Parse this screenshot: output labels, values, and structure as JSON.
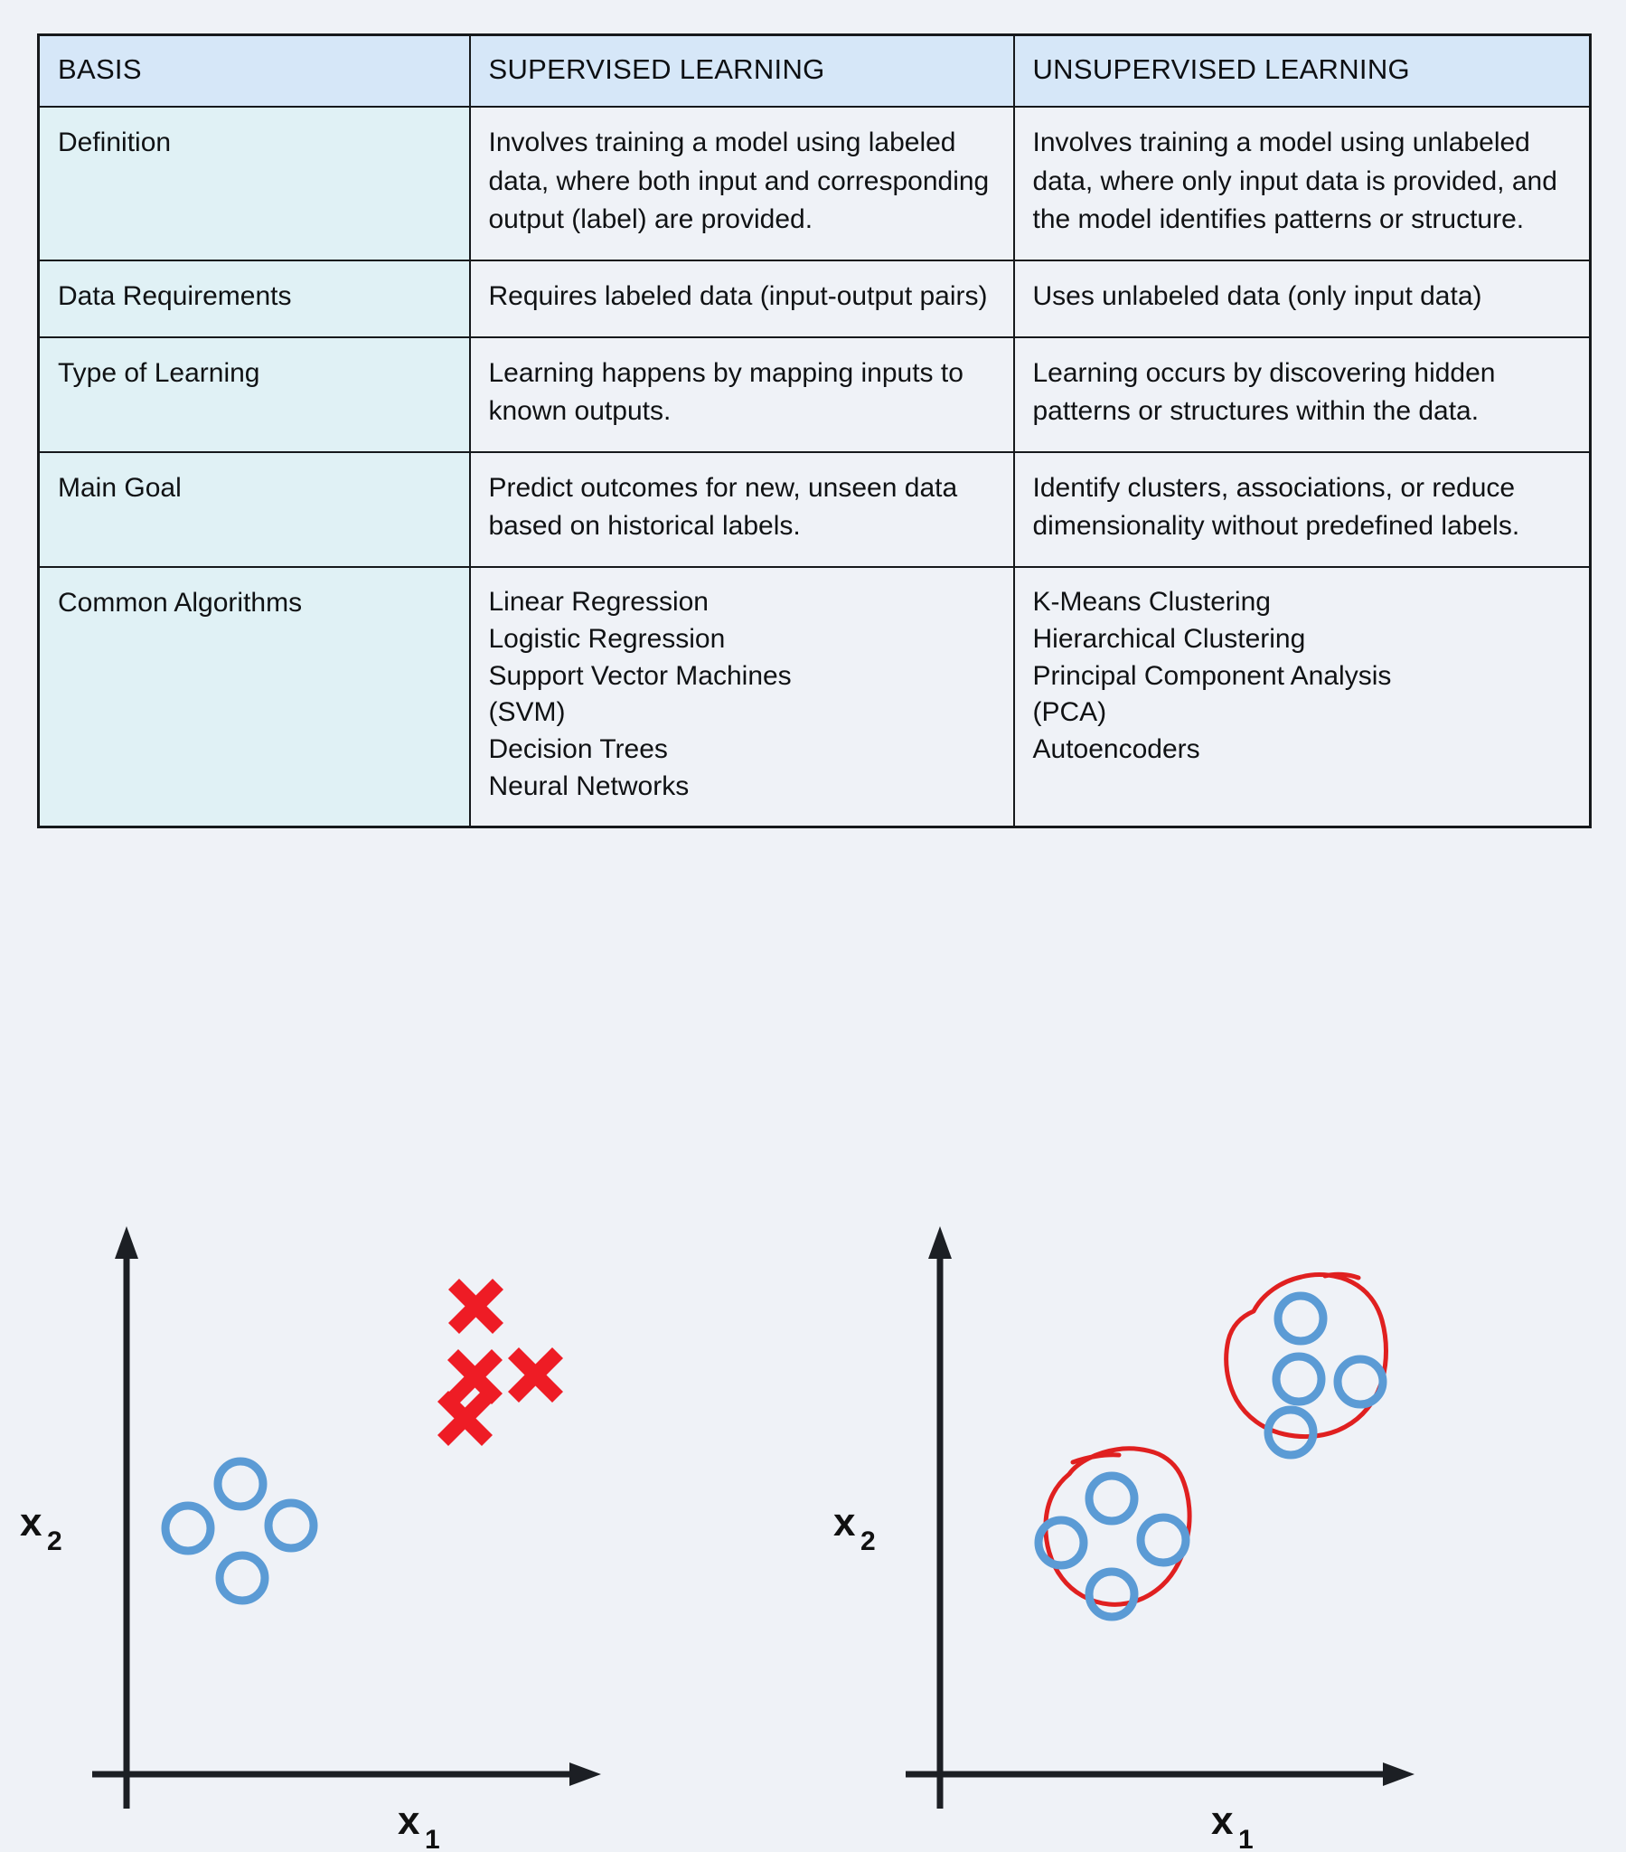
{
  "table": {
    "headers": [
      "BASIS",
      "SUPERVISED LEARNING",
      "UNSUPERVISED LEARNING"
    ],
    "rows": [
      {
        "basis": "Definition",
        "supervised": "Involves training a model using labeled data, where both input and corresponding output (label) are provided.",
        "unsupervised": "Involves training a model using unlabeled data, where only input data is provided, and the model identifies patterns or structure."
      },
      {
        "basis": "Data Requirements",
        "supervised": "Requires labeled data (input-output pairs)",
        "unsupervised": "Uses unlabeled data (only input data)"
      },
      {
        "basis": "Type of Learning",
        "supervised": "Learning happens by mapping inputs to known outputs.",
        "unsupervised": "Learning occurs by discovering hidden patterns or structures within the data."
      },
      {
        "basis": "Main Goal",
        "supervised": "Predict outcomes for new, unseen data based on historical labels.",
        "unsupervised": "Identify clusters, associations, or reduce dimensionality without predefined labels."
      },
      {
        "basis": "Common Algorithms",
        "supervised_list": [
          "Linear Regression",
          "Logistic Regression",
          "Support Vector Machines",
          "(SVM)",
          "Decision Trees",
          "Neural Networks"
        ],
        "unsupervised_list": [
          "K-Means Clustering",
          "Hierarchical Clustering",
          "Principal Component Analysis",
          "(PCA)",
          "Autoencoders"
        ]
      }
    ]
  },
  "colors": {
    "page_background": "#eff2f7",
    "header_fill": "#d6e7f8",
    "basis_column_fill": "#e0f1f5",
    "cell_fill": "#eff2f7",
    "border": "#16191c",
    "marker_circle": "#5b9bd5",
    "marker_cross": "#ee1c25",
    "cluster_outline": "#e02020",
    "axis": "#1c1f24"
  },
  "chart_data": [
    {
      "type": "scatter",
      "title": "Supervised learning scatter",
      "xlabel": "x₁",
      "ylabel": "x₂",
      "axis_label_x_main": "x",
      "axis_label_x_sub": "1",
      "axis_label_y_main": "x",
      "axis_label_y_sub": "2",
      "grid": false,
      "legend": "none",
      "series": [
        {
          "name": "class-circle",
          "marker": "circle",
          "color": "#5b9bd5",
          "points": [
            [
              0.3,
              0.46
            ],
            [
              0.22,
              0.38
            ],
            [
              0.38,
              0.38
            ],
            [
              0.3,
              0.3
            ]
          ]
        },
        {
          "name": "class-cross",
          "marker": "cross",
          "color": "#ee1c25",
          "points": [
            [
              0.62,
              0.8
            ],
            [
              0.61,
              0.68
            ],
            [
              0.75,
              0.67
            ],
            [
              0.59,
              0.59
            ]
          ]
        }
      ]
    },
    {
      "type": "scatter",
      "title": "Unsupervised learning clusters",
      "xlabel": "x₁",
      "ylabel": "x₂",
      "axis_label_x_main": "x",
      "axis_label_x_sub": "1",
      "axis_label_y_main": "x",
      "axis_label_y_sub": "2",
      "grid": false,
      "legend": "none",
      "series": [
        {
          "name": "points",
          "marker": "circle",
          "color": "#5b9bd5",
          "points": [
            [
              0.29,
              0.5
            ],
            [
              0.22,
              0.42
            ],
            [
              0.37,
              0.43
            ],
            [
              0.29,
              0.3
            ],
            [
              0.64,
              0.78
            ],
            [
              0.62,
              0.66
            ],
            [
              0.76,
              0.65
            ],
            [
              0.61,
              0.56
            ]
          ]
        }
      ],
      "annotations": [
        {
          "type": "hand-drawn-cluster-outline",
          "name": "cluster-1",
          "color": "#e02020",
          "around": "lower-left group"
        },
        {
          "type": "hand-drawn-cluster-outline",
          "name": "cluster-2",
          "color": "#e02020",
          "around": "upper-right group"
        }
      ]
    }
  ]
}
